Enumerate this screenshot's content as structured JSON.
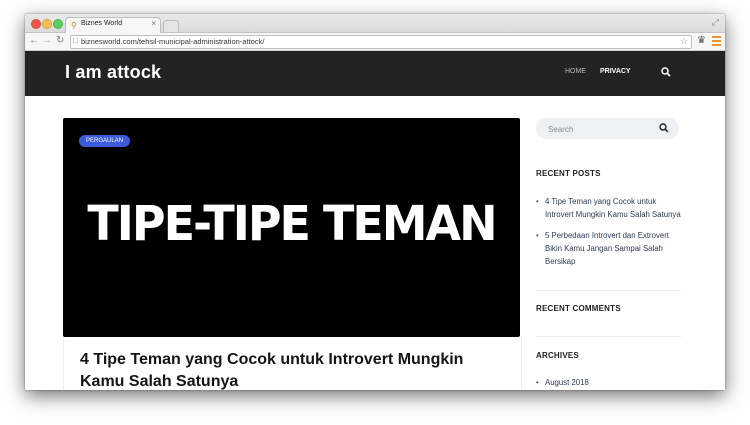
{
  "browser": {
    "tab_title": "Biznes World",
    "tab_close": "×",
    "url": "biznesworld.com/tehsil-municipal-administration-attock/",
    "icons": {
      "back": "back-arrow-icon",
      "forward": "forward-arrow-icon",
      "reload": "reload-icon",
      "star": "star-icon",
      "menu": "hamburger-menu-icon"
    },
    "menu_color": "#f0932b"
  },
  "site": {
    "title": "I am attock",
    "nav": {
      "home": "HOME",
      "privacy": "PRIVACY"
    },
    "header_bg": "#232323"
  },
  "hero": {
    "badge": "PERGAULAN",
    "badge_color": "#3b5bdb",
    "image_text": "TIPE-TIPE TEMAN"
  },
  "post": {
    "title": "4 Tipe Teman yang Cocok untuk Introvert Mungkin Kamu Salah Satunya"
  },
  "sidebar": {
    "search_placeholder": "Search",
    "recent_posts_title": "RECENT POSTS",
    "recent_posts": [
      "4 Tipe Teman yang Cocok untuk Introvert Mungkin Kamu Salah Satunya",
      "5 Perbedaan Introvert dan Extrovert Bikin Kamu Jangan Sampai Salah Bersikap"
    ],
    "recent_comments_title": "RECENT COMMENTS",
    "archives_title": "ARCHIVES",
    "archives": [
      "August 2018"
    ]
  }
}
